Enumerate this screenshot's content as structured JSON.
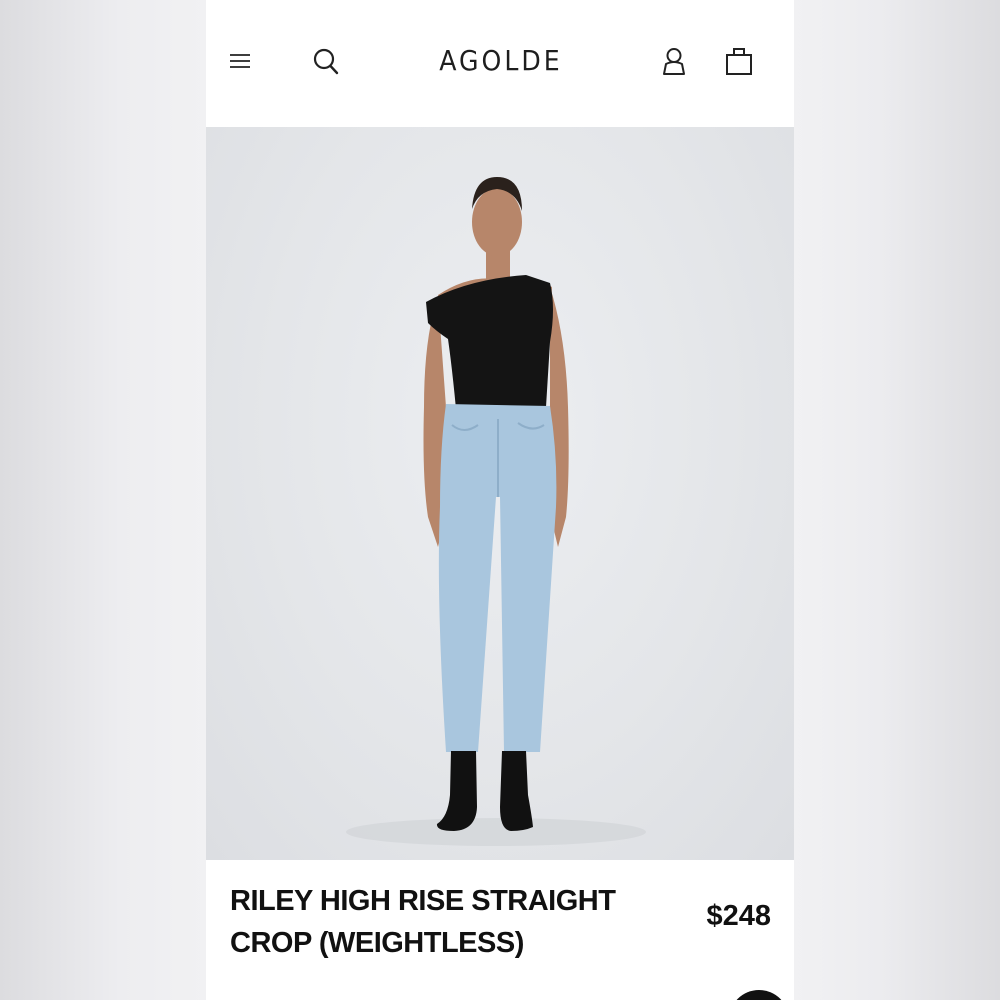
{
  "header": {
    "brand": "AGOLDE",
    "icons": [
      "menu-icon",
      "search-icon",
      "account-icon",
      "shopping-bag-icon"
    ]
  },
  "product": {
    "title": "RILEY HIGH RISE STRAIGHT CROP (WEIGHTLESS)",
    "price": "$248"
  },
  "colors": {
    "text": "#111111",
    "backdrop": "#e6e8eb",
    "denim": "#a9c6de",
    "top": "#141414"
  }
}
